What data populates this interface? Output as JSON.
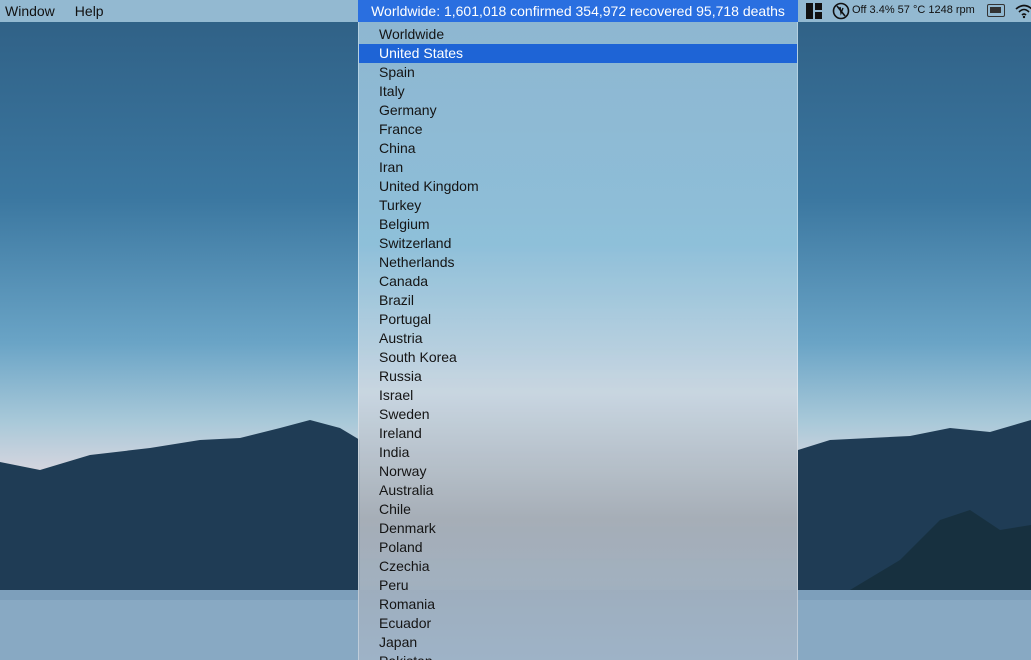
{
  "menubar": {
    "menus": [
      "Window",
      "Help"
    ],
    "status_title": "Worldwide: 1,601,018 confirmed 354,972 recovered 95,718 deaths",
    "system_stats": "Off 3.4% 57 °C 1248 rpm"
  },
  "dropdown": {
    "selected_index": 1,
    "items": [
      "Worldwide",
      "United States",
      "Spain",
      "Italy",
      "Germany",
      "France",
      "China",
      "Iran",
      "United Kingdom",
      "Turkey",
      "Belgium",
      "Switzerland",
      "Netherlands",
      "Canada",
      "Brazil",
      "Portugal",
      "Austria",
      "South Korea",
      "Russia",
      "Israel",
      "Sweden",
      "Ireland",
      "India",
      "Norway",
      "Australia",
      "Chile",
      "Denmark",
      "Poland",
      "Czechia",
      "Peru",
      "Romania",
      "Ecuador",
      "Japan",
      "Pakistan"
    ]
  },
  "icons": {
    "tiles": "window-tiles-icon",
    "stats": "system-monitor-icon",
    "battery": "battery-icon",
    "wifi": "wifi-icon"
  },
  "colors": {
    "status_accent": "#2a6fe0",
    "selection": "#1e64d6"
  }
}
